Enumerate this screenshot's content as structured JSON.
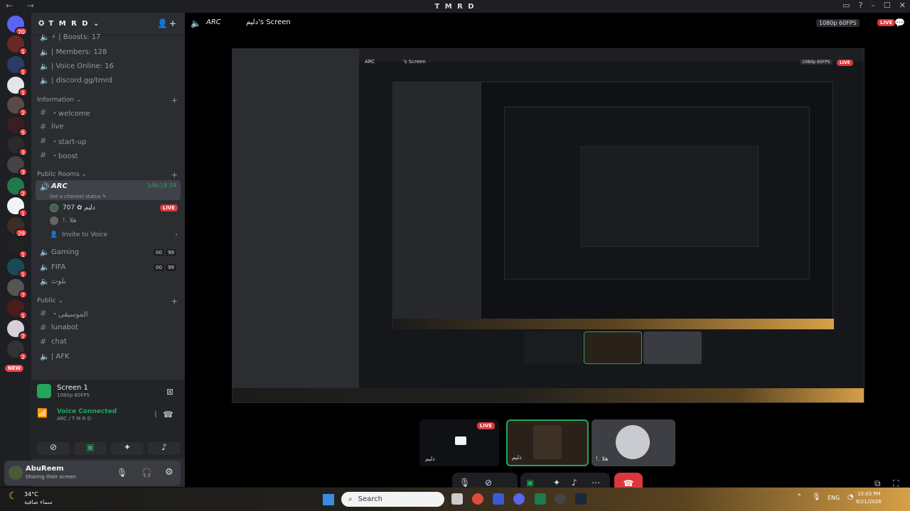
{
  "window": {
    "title": "T M R D",
    "nav": "← →"
  },
  "guild": {
    "name": "T M R D ⌄"
  },
  "server_badges": [
    "70",
    "1",
    "1",
    "1",
    "2",
    "5",
    "3",
    "3",
    "2",
    "1",
    "29",
    "1",
    "1",
    "7",
    "1",
    "2",
    "2"
  ],
  "new_badge": "NEW",
  "stats": [
    {
      "label": "⚡ | Boosts: 17"
    },
    {
      "label": "| Members: 128"
    },
    {
      "label": "| Voice Online: 16"
    },
    {
      "label": "| discord.gg/tmrd"
    }
  ],
  "categories": {
    "information": "Information ⌄",
    "public_rooms": "Public Rooms ⌄",
    "public": "Public ⌄"
  },
  "text_channels": [
    {
      "label": "・welcome"
    },
    {
      "label": "live"
    },
    {
      "label": "・start-up"
    },
    {
      "label": "・boost"
    }
  ],
  "voice": {
    "arc": "ARC",
    "arc_time": "146:18:34",
    "status_hint": "Set a channel status ✎",
    "members": [
      {
        "name": "دليم ✿ 707",
        "live": "LIVE"
      },
      {
        "name": "!. هلا"
      }
    ],
    "invite": "Invite to Voice",
    "gaming": "Gaming",
    "gaming_counts": [
      "00",
      "99"
    ],
    "fifa": "FIFA",
    "fifa_counts": [
      "00",
      "99"
    ],
    "batoot": "بلوت"
  },
  "public_channels": [
    {
      "label": "・الموسيقى"
    },
    {
      "label": "lunabot"
    },
    {
      "label": "chat"
    },
    {
      "label": "| AFK"
    }
  ],
  "rtc": {
    "screen_title": "Screen 1",
    "screen_sub": "1080p 60FPS",
    "connected": "Voice Connected",
    "location": "ARC / T M R D"
  },
  "user": {
    "name": "AbuReem",
    "status": "Sharing their screen"
  },
  "stage_header": {
    "channel": "ARC",
    "viewer": "دليم's Screen",
    "quality": "1080p 60FPS",
    "live": "LIVE"
  },
  "inner_header": {
    "channel": "ARC",
    "viewer": "'s Screen",
    "quality": "1080p 60FPS",
    "live": "LIVE"
  },
  "tiles": [
    {
      "label": "دليم",
      "live": "LIVE"
    },
    {
      "label": "دليم"
    },
    {
      "label": "!. هلا"
    }
  ],
  "taskbar": {
    "temp": "34°C",
    "weather": "سماء صافية",
    "search": "Search",
    "lang": "ENG",
    "time": "10:03 PM",
    "date": "6/21/2026"
  },
  "colors": {
    "accent": "#5865f2",
    "live": "#da373c",
    "green": "#23a55a",
    "sidebar": "#2b2d31",
    "rail": "#1e1f22"
  }
}
